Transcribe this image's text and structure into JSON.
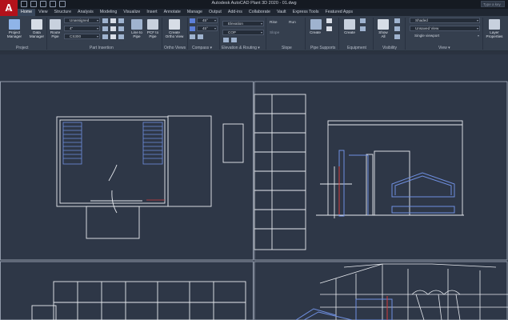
{
  "app": {
    "logo_letter": "A",
    "logo_sub": "PLANT 3D",
    "window_title": "Autodesk AutoCAD Plant 3D 2020  -  01.dwg",
    "search_placeholder": "Type a key"
  },
  "tabs": [
    "Home",
    "View",
    "Structure",
    "Analysis",
    "Modeling",
    "Visualize",
    "Insert",
    "Annotate",
    "Manage",
    "Output",
    "Add-ins",
    "Collaborate",
    "Vault",
    "Express Tools",
    "Featured Apps"
  ],
  "active_tab": "Home",
  "ribbon": {
    "project_manager": "Project\nManager",
    "data_manager": "Data\nManager",
    "route_pipe": "Route\nPipe",
    "line_to_pipe": "Line to\nPipe",
    "pcf_to_pipe": "PCF to\nPipe",
    "create_ortho_view": "Create\nOrtho View",
    "spec_dropdown": "Unassigned",
    "size_dropdown": "4\"",
    "spec2_dropdown": "CS300",
    "angle1": "45°",
    "angle2": "45°",
    "elevation_label": "Elevation",
    "elevation_value": "0",
    "cop_dropdown": "COP",
    "rise_label": "Rise",
    "run_label": "Run",
    "slope_label": "Slope",
    "create_label": "Create",
    "create2_label": "Create",
    "show_all": "Show\nAll",
    "visual_style": "Shaded",
    "view_dropdown": "Unsaved View",
    "viewport": "Single viewport",
    "layer_properties": "Layer\nProperties",
    "panels": [
      "Project",
      "Part Insertion",
      "Ortho Views",
      "Compass ▾",
      "Elevation & Routing ▾",
      "Slope",
      "Pipe Supports",
      "Equipment",
      "Visibility",
      "View ▾"
    ]
  },
  "colors": {
    "background": "#2e3747",
    "ribbon": "#353f4e",
    "line_white": "#e8ebf0",
    "line_blue": "#6f8fe0",
    "line_red": "#d23a3a"
  }
}
